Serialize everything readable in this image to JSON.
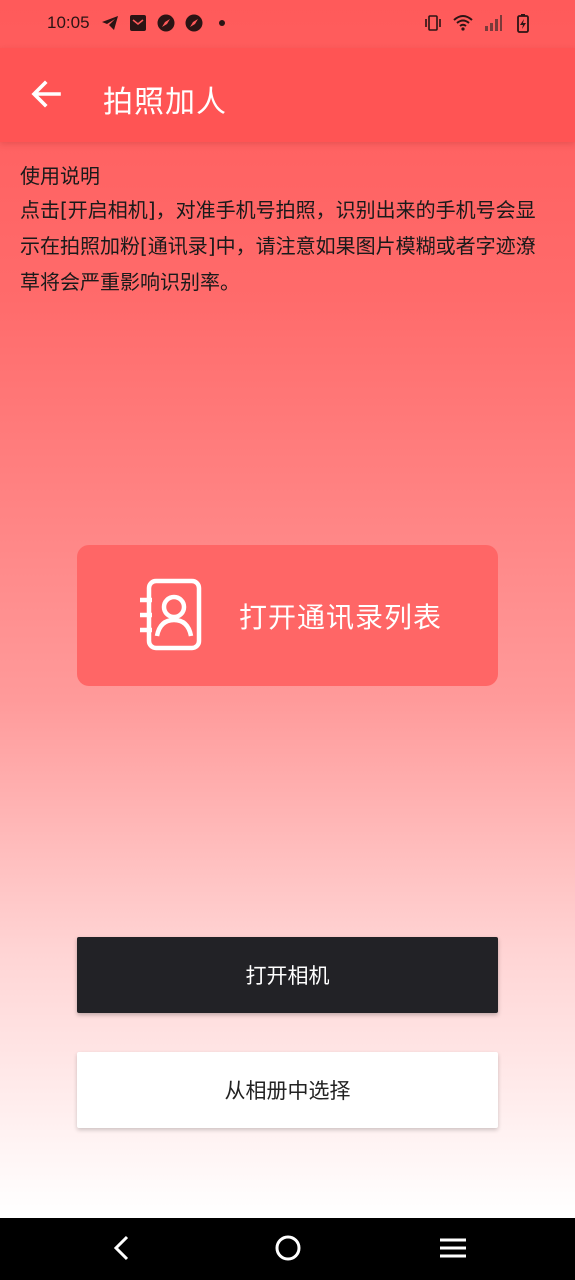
{
  "status_bar": {
    "time": "10:05",
    "left_icons": [
      "telegram-icon",
      "mail-icon",
      "compass-icon",
      "compass-icon",
      "dot-icon"
    ],
    "right_icons": [
      "vibrate-icon",
      "wifi-icon",
      "signal-icon",
      "battery-charging-icon"
    ]
  },
  "app_bar": {
    "title": "拍照加人",
    "back_icon": "arrow-left-icon"
  },
  "instructions": {
    "title": "使用说明",
    "body": "点击[开启相机]，对准手机号拍照，识别出来的手机号会显示在拍照加粉[通讯录]中，请注意如果图片模糊或者字迹潦草将会严重影响识别率。"
  },
  "contacts_button": {
    "label": "打开通讯录列表",
    "icon": "contact-book-icon"
  },
  "actions": {
    "camera_label": "打开相机",
    "album_label": "从相册中选择"
  },
  "nav_bar": {
    "icons": [
      "back-chevron-icon",
      "home-circle-icon",
      "menu-icon"
    ]
  },
  "colors": {
    "app_bar": "#ff5454",
    "contacts_card": "#ff6666",
    "camera_button": "#222226",
    "album_button": "#ffffff"
  }
}
